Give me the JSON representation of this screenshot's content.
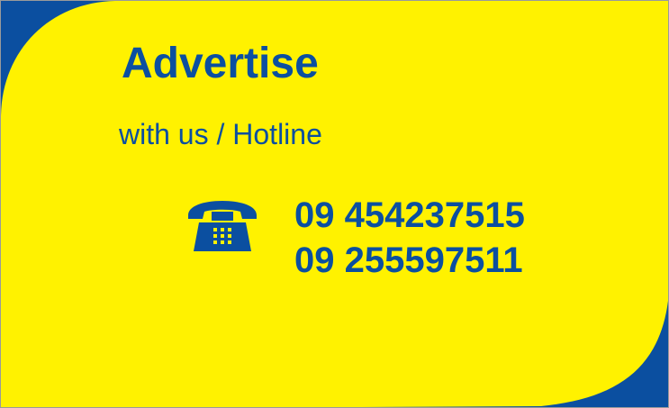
{
  "banner": {
    "title": "Advertise",
    "subtitle": "with us / Hotline",
    "icon": "telephone-icon",
    "phone_numbers": [
      "09 454237515",
      "09 255597511"
    ]
  },
  "colors": {
    "background_blue": "#0b4fa0",
    "card_yellow": "#fff200",
    "text_blue": "#0b4fa0"
  }
}
